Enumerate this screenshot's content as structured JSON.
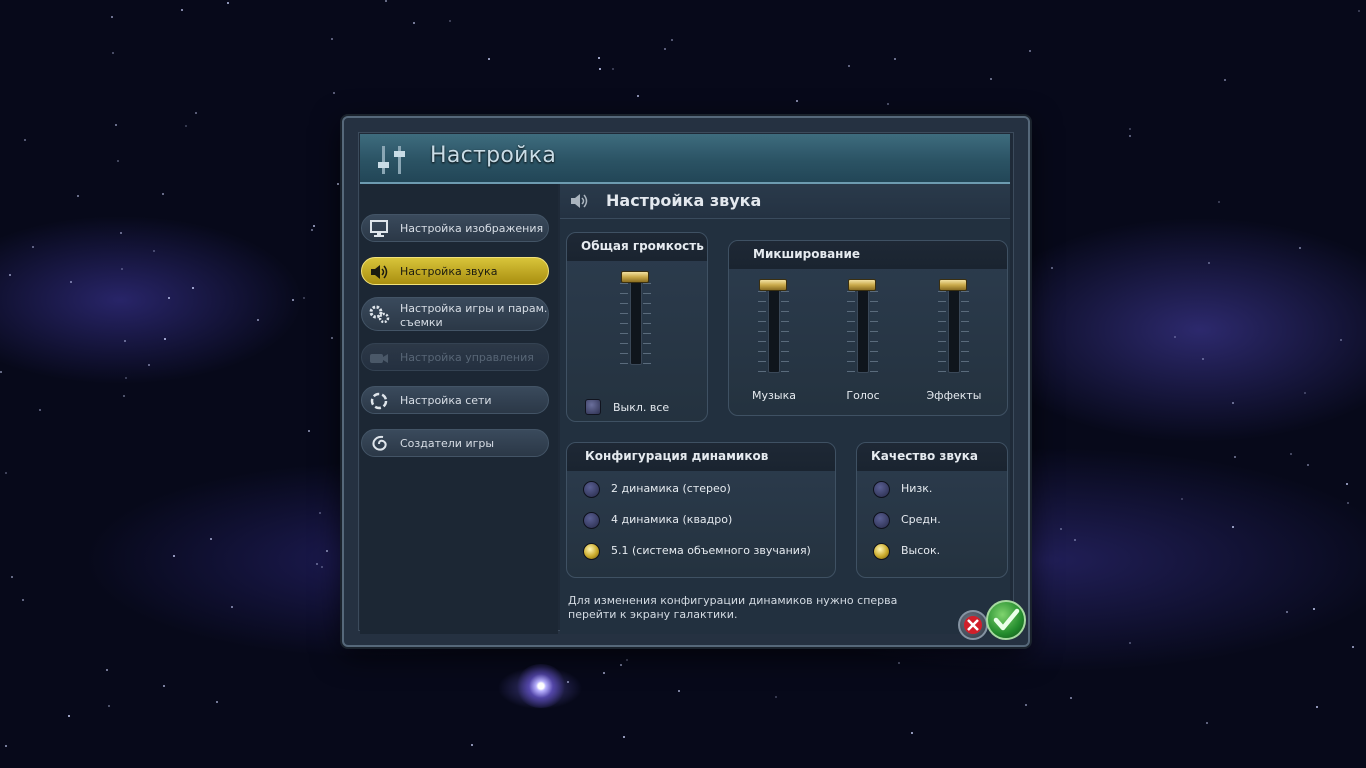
{
  "dialog": {
    "title": "Настройка"
  },
  "sidebar": {
    "items": [
      {
        "label": "Настройка изображения",
        "icon": "monitor-icon",
        "state": "normal"
      },
      {
        "label": "Настройка звука",
        "icon": "speaker-icon",
        "state": "active"
      },
      {
        "label": "Настройка игры и парам. съемки",
        "icon": "gears-icon",
        "state": "normal"
      },
      {
        "label": "Настройка управления",
        "icon": "controller-icon",
        "state": "disabled"
      },
      {
        "label": "Настройка сети",
        "icon": "network-icon",
        "state": "normal"
      },
      {
        "label": "Создатели игры",
        "icon": "spiral-icon",
        "state": "normal"
      }
    ]
  },
  "content": {
    "title": "Настройка звука",
    "master_volume": {
      "title": "Общая громкость",
      "level": 1.0,
      "mute_all_label": "Выкл. все",
      "mute_all_checked": false
    },
    "mixing": {
      "title": "Микширование",
      "channels": [
        {
          "label": "Музыка",
          "level": 1.0
        },
        {
          "label": "Голос",
          "level": 1.0
        },
        {
          "label": "Эффекты",
          "level": 1.0
        }
      ]
    },
    "speaker_config": {
      "title": "Конфигурация динамиков",
      "options": [
        {
          "label": "2 динамика (стерео)",
          "selected": false
        },
        {
          "label": "4 динамика (квадро)",
          "selected": false
        },
        {
          "label": "5.1 (система объемного звучания)",
          "selected": true
        }
      ]
    },
    "sound_quality": {
      "title": "Качество звука",
      "options": [
        {
          "label": "Низк.",
          "selected": false
        },
        {
          "label": "Средн.",
          "selected": false
        },
        {
          "label": "Высок.",
          "selected": true
        }
      ]
    },
    "note": "Для изменения конфигурации динамиков нужно сперва перейти к экрану галактики."
  },
  "colors": {
    "active_tab": "#c9b21e",
    "accent_gold": "#c9a94a",
    "ok_green": "#238c2d",
    "cancel_red": "#d11f2a"
  }
}
